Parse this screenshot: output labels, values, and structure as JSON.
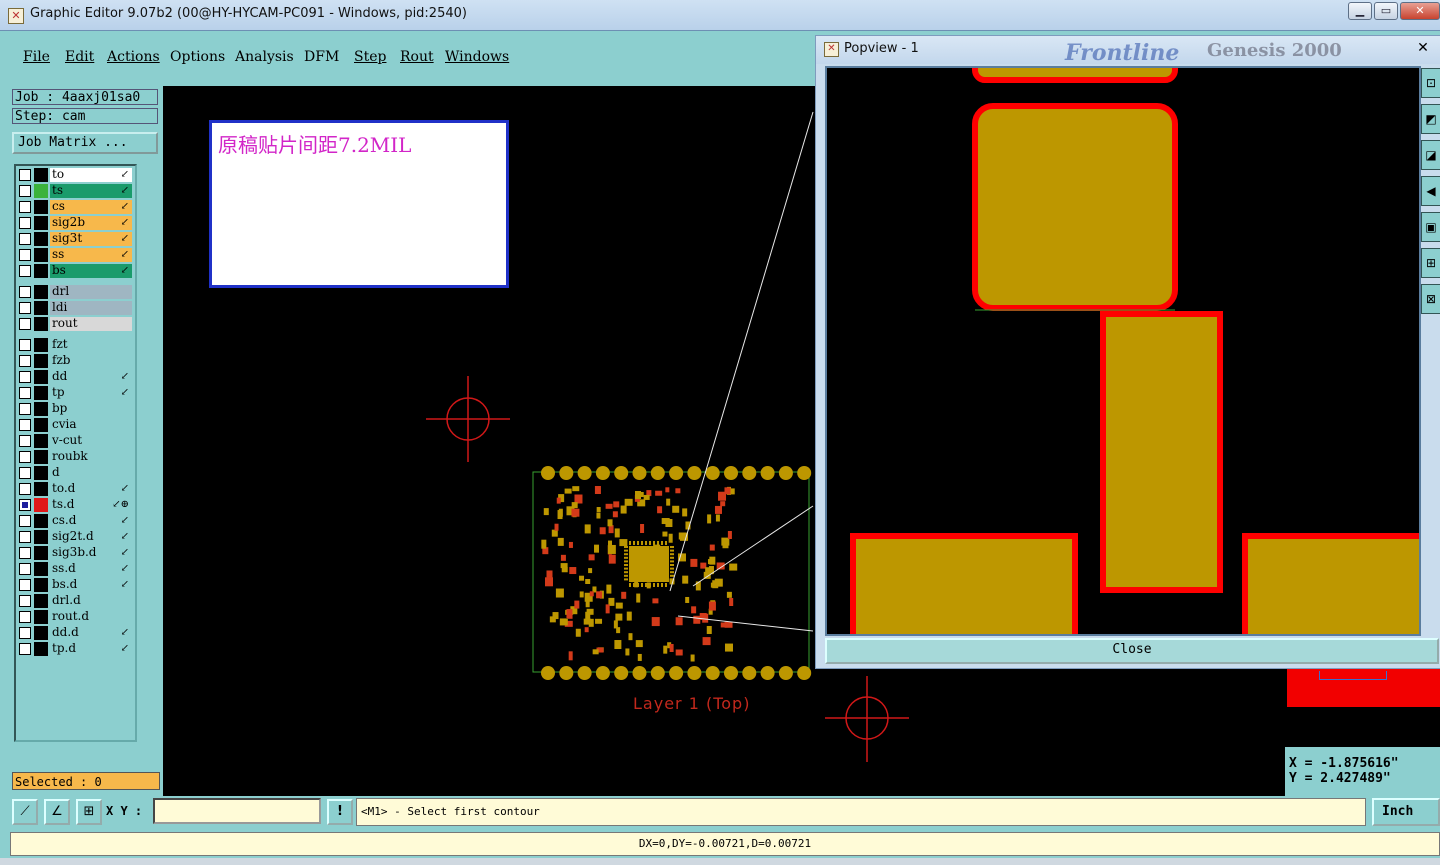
{
  "window": {
    "title": "Graphic Editor 9.07b2 (00@HY-HYCAM-PC091 - Windows, pid:2540)",
    "icon": "app-icon"
  },
  "menubar": {
    "items": [
      "File",
      "Edit",
      "Actions",
      "Options",
      "Analysis",
      "DFM",
      "Step",
      "Rout",
      "Windows"
    ]
  },
  "left_panel": {
    "job": "Job : 4aaxj01sa0",
    "step": "Step: cam",
    "job_matrix": "Job Matrix ...",
    "selected": "Selected : 0",
    "layers": [
      {
        "name": "to",
        "color": "#ffffff",
        "swatch": "#000000",
        "arrow": "↙"
      },
      {
        "name": "ts",
        "color": "#1a9b6b",
        "swatch": "#3bb33b",
        "arrow": "↙"
      },
      {
        "name": "cs",
        "color": "#f7b84b",
        "swatch": "#000000",
        "arrow": "↙"
      },
      {
        "name": "sig2b",
        "color": "#f7b84b",
        "swatch": "#000000",
        "arrow": "↙"
      },
      {
        "name": "sig3t",
        "color": "#f7b84b",
        "swatch": "#000000",
        "arrow": "↙"
      },
      {
        "name": "ss",
        "color": "#f7b84b",
        "swatch": "#000000",
        "arrow": "↙"
      },
      {
        "name": "bs",
        "color": "#1a9b6b",
        "swatch": "#000000",
        "arrow": "↙"
      },
      {
        "name": "drl",
        "color": "#9fb6c2",
        "swatch": "#000000",
        "arrow": ""
      },
      {
        "name": "ldi",
        "color": "#9fb6c2",
        "swatch": "#000000",
        "arrow": ""
      },
      {
        "name": "rout",
        "color": "#d8d8d8",
        "swatch": "#000000",
        "arrow": ""
      },
      {
        "name": "fzt",
        "color": "#8ccfcf",
        "swatch": "#000000",
        "arrow": ""
      },
      {
        "name": "fzb",
        "color": "#8ccfcf",
        "swatch": "#000000",
        "arrow": ""
      },
      {
        "name": "dd",
        "color": "#8ccfcf",
        "swatch": "#000000",
        "arrow": "↙"
      },
      {
        "name": "tp",
        "color": "#8ccfcf",
        "swatch": "#000000",
        "arrow": "↙"
      },
      {
        "name": "bp",
        "color": "#8ccfcf",
        "swatch": "#000000",
        "arrow": ""
      },
      {
        "name": "cvia",
        "color": "#8ccfcf",
        "swatch": "#000000",
        "arrow": ""
      },
      {
        "name": "v-cut",
        "color": "#8ccfcf",
        "swatch": "#000000",
        "arrow": ""
      },
      {
        "name": "roubk",
        "color": "#8ccfcf",
        "swatch": "#000000",
        "arrow": ""
      },
      {
        "name": "d",
        "color": "#8ccfcf",
        "swatch": "#000000",
        "arrow": ""
      },
      {
        "name": "to.d",
        "color": "#8ccfcf",
        "swatch": "#000000",
        "arrow": "↙"
      },
      {
        "name": "ts.d",
        "color": "#8ccfcf",
        "swatch": "#e01818",
        "arrow": "↙⊕",
        "checked": true
      },
      {
        "name": "cs.d",
        "color": "#8ccfcf",
        "swatch": "#000000",
        "arrow": "↙"
      },
      {
        "name": "sig2t.d",
        "color": "#8ccfcf",
        "swatch": "#000000",
        "arrow": "↙"
      },
      {
        "name": "sig3b.d",
        "color": "#8ccfcf",
        "swatch": "#000000",
        "arrow": "↙"
      },
      {
        "name": "ss.d",
        "color": "#8ccfcf",
        "swatch": "#000000",
        "arrow": "↙"
      },
      {
        "name": "bs.d",
        "color": "#8ccfcf",
        "swatch": "#000000",
        "arrow": "↙"
      },
      {
        "name": "drl.d",
        "color": "#8ccfcf",
        "swatch": "#000000",
        "arrow": ""
      },
      {
        "name": "rout.d",
        "color": "#8ccfcf",
        "swatch": "#000000",
        "arrow": ""
      },
      {
        "name": "dd.d",
        "color": "#8ccfcf",
        "swatch": "#000000",
        "arrow": "↙"
      },
      {
        "name": "tp.d",
        "color": "#8ccfcf",
        "swatch": "#000000",
        "arrow": "↙"
      }
    ]
  },
  "canvas": {
    "note": "原稿贴片间距7.2MIL",
    "layer_label": "Layer 1 (Top)"
  },
  "popview": {
    "title": "Popview - 1",
    "close_label": "Close",
    "background_brand": "Frontline",
    "background_product": "Genesis 2000"
  },
  "coords": {
    "x": "X = -1.875616\"",
    "y": "Y = 2.427489\""
  },
  "bottombar": {
    "xy_label": "X Y :",
    "xy_value": "",
    "warn_icon": "!",
    "message": "<M1> - Select first contour",
    "unit": "Inch"
  },
  "status": "DX=0,DY=-0.00721,D=0.00721",
  "colors": {
    "pad": "#bd9700",
    "pad_outline": "#ff0000",
    "canvas": "#000000",
    "panel": "#8ccfcf"
  }
}
